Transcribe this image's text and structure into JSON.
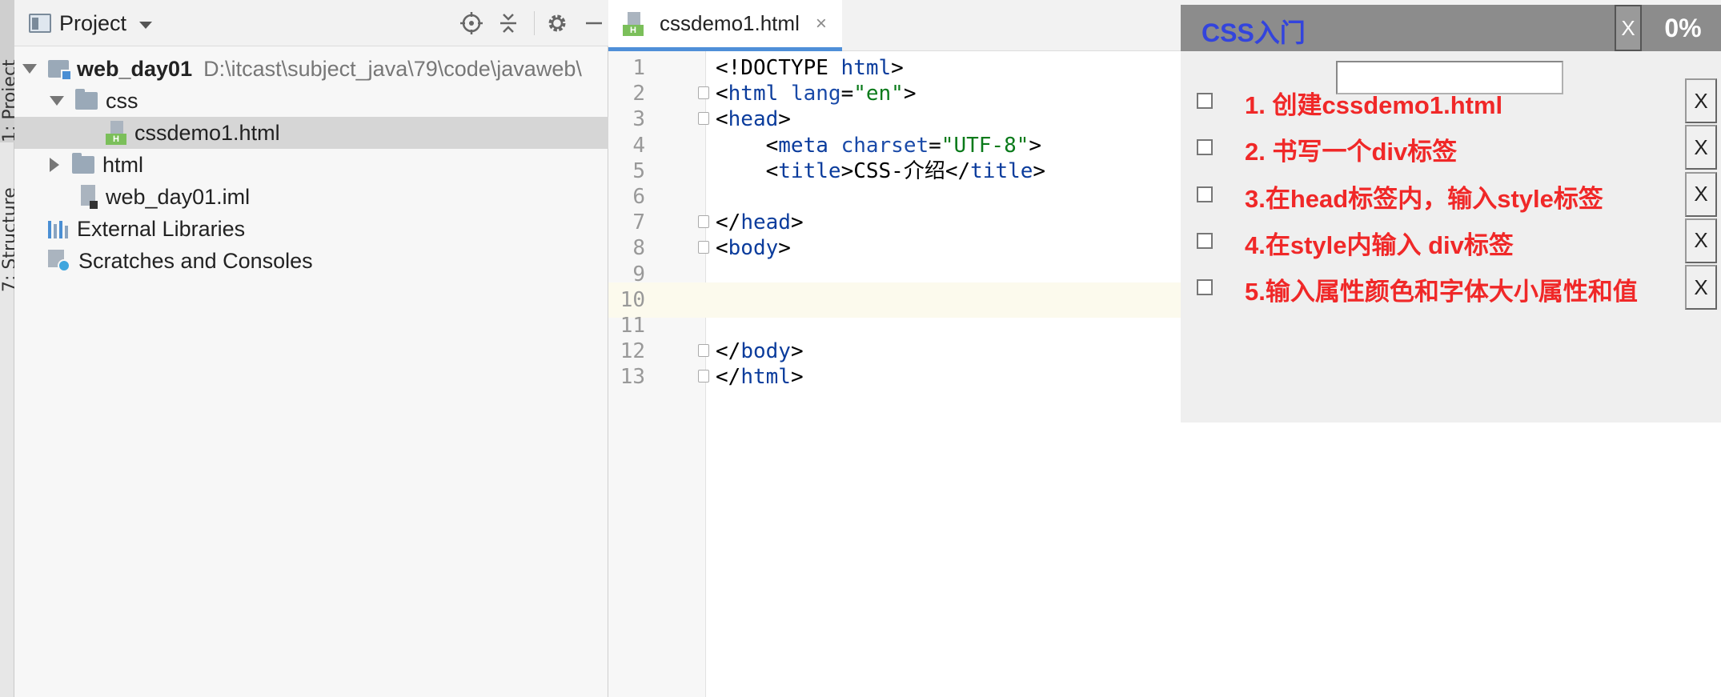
{
  "side_strip": {
    "tab_project": "1: Project",
    "tab_structure": "7: Structure"
  },
  "project_panel": {
    "title": "Project",
    "toolbar_icons": [
      "locate-icon",
      "collapse-all-icon",
      "gear-icon",
      "minimize-icon"
    ],
    "tree": {
      "root_name": "web_day01",
      "root_path": "D:\\itcast\\subject_java\\79\\code\\javaweb\\",
      "folder_css": "css",
      "file_cssdemo": "cssdemo1.html",
      "folder_html": "html",
      "file_iml": "web_day01.iml",
      "external_libraries": "External Libraries",
      "scratches": "Scratches and Consoles"
    }
  },
  "editor": {
    "tab_label": "cssdemo1.html",
    "tab_close": "×",
    "current_line": 10,
    "lines": [
      {
        "n": "1",
        "parts": [
          [
            "t",
            "<!DOCTYPE "
          ],
          [
            "tag",
            "html"
          ],
          [
            "t",
            ">"
          ]
        ]
      },
      {
        "n": "2",
        "parts": [
          [
            "t",
            "<"
          ],
          [
            "tag",
            "html "
          ],
          [
            "attr",
            "lang"
          ],
          [
            "t",
            "="
          ],
          [
            "str",
            "\"en\""
          ],
          [
            "t",
            ">"
          ]
        ]
      },
      {
        "n": "3",
        "parts": [
          [
            "t",
            "<"
          ],
          [
            "tag",
            "head"
          ],
          [
            "t",
            ">"
          ]
        ]
      },
      {
        "n": "4",
        "parts": [
          [
            "t",
            "    <"
          ],
          [
            "tag",
            "meta "
          ],
          [
            "attr",
            "charset"
          ],
          [
            "t",
            "="
          ],
          [
            "str",
            "\"UTF-8\""
          ],
          [
            "t",
            ">"
          ]
        ]
      },
      {
        "n": "5",
        "parts": [
          [
            "t",
            "    <"
          ],
          [
            "tag",
            "title"
          ],
          [
            "t",
            ">CSS-介绍</"
          ],
          [
            "tag",
            "title"
          ],
          [
            "t",
            ">"
          ]
        ]
      },
      {
        "n": "6",
        "parts": []
      },
      {
        "n": "7",
        "parts": [
          [
            "t",
            "</"
          ],
          [
            "tag",
            "head"
          ],
          [
            "t",
            ">"
          ]
        ]
      },
      {
        "n": "8",
        "parts": [
          [
            "t",
            "<"
          ],
          [
            "tag",
            "body"
          ],
          [
            "t",
            ">"
          ]
        ]
      },
      {
        "n": "9",
        "parts": []
      },
      {
        "n": "10",
        "parts": []
      },
      {
        "n": "11",
        "parts": []
      },
      {
        "n": "12",
        "parts": [
          [
            "t",
            "</"
          ],
          [
            "tag",
            "body"
          ],
          [
            "t",
            ">"
          ]
        ]
      },
      {
        "n": "13",
        "parts": [
          [
            "t",
            "</"
          ],
          [
            "tag",
            "html"
          ],
          [
            "t",
            ">"
          ]
        ]
      }
    ]
  },
  "checklist": {
    "title": "CSS入门",
    "close_label": "X",
    "progress": "0%",
    "input_value": "",
    "delete_label": "X",
    "tasks": [
      "1. 创建cssdemo1.html",
      "2. 书写一个div标签",
      "3.在head标签内，输入style标签",
      "4.在style内输入 div标签",
      "5.输入属性颜色和字体大小属性和值"
    ]
  },
  "colors": {
    "accent_tab": "#4f8fd8",
    "task_text": "#f02828",
    "checklist_title": "#3344dd",
    "xml_tag": "#0b3c9c",
    "xml_string": "#0a7a1a"
  }
}
